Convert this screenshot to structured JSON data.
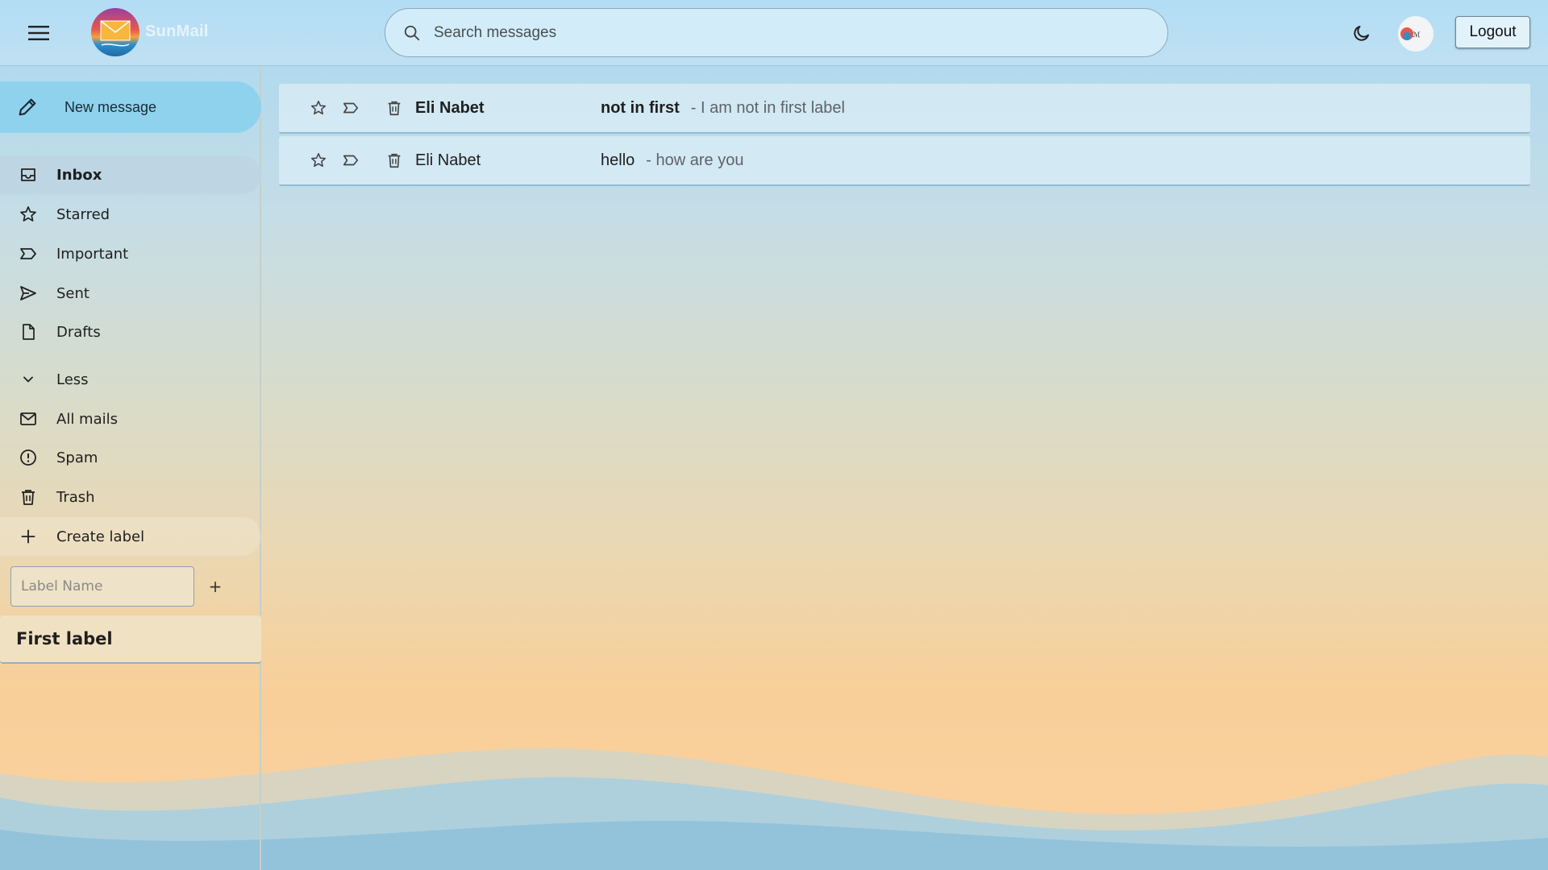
{
  "app": {
    "brand": "SunMail"
  },
  "header": {
    "search_placeholder": "Search messages",
    "logout_label": "Logout"
  },
  "sidebar": {
    "compose_label": "New message",
    "items": [
      {
        "label": "Inbox",
        "icon": "inbox-icon",
        "active": true
      },
      {
        "label": "Starred",
        "icon": "star-icon"
      },
      {
        "label": "Important",
        "icon": "important-icon"
      },
      {
        "label": "Sent",
        "icon": "send-icon"
      },
      {
        "label": "Drafts",
        "icon": "draft-icon"
      },
      {
        "label": "Less",
        "icon": "chevron-down-icon"
      },
      {
        "label": "All mails",
        "icon": "mail-icon"
      },
      {
        "label": "Spam",
        "icon": "spam-icon"
      },
      {
        "label": "Trash",
        "icon": "trash-icon"
      },
      {
        "label": "Create label",
        "icon": "plus-icon"
      }
    ],
    "label_input_placeholder": "Label Name",
    "label_add": "+",
    "labels": [
      {
        "name": "First label"
      }
    ]
  },
  "mails": [
    {
      "sender": "Eli Nabet",
      "subject": "not in first",
      "snippet": "- I am not in first label",
      "unread": true
    },
    {
      "sender": "Eli Nabet",
      "subject": "hello",
      "snippet": "- how are you",
      "unread": false
    }
  ],
  "colors": {
    "accent": "#8fd2ee",
    "active_nav": "#bed5e3",
    "header": "#b2ddf5"
  }
}
